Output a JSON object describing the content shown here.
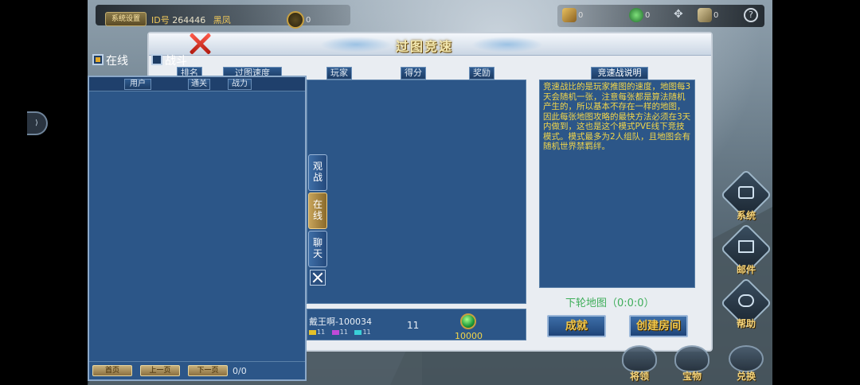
{
  "topbar": {
    "settings_label": "系统设置",
    "id_label": "ID号",
    "id_value": "264446",
    "nick": "黑凤",
    "coin_value": "0",
    "res_gold": "0",
    "res_gem": "0",
    "res_scroll": "0"
  },
  "panel": {
    "title": "过图竞速",
    "columns": [
      "排名",
      "过图速度",
      "玩家",
      "得分",
      "奖励"
    ],
    "desc_title": "竞速战说明",
    "desc_text": "竞速战比的是玩家推图的速度，地图每3天会随机一张，注意每张都是算法随机产生的，所以基本不存在一样的地图，因此每张地图攻略的最快方法必须在3天内做到，这也是这个模式PVE线下竞技模式。模式最多为2人组队，且地图会有随机世界禁羁绊。",
    "next_map": "下轮地图（0:0:0）",
    "achievement_btn": "成就",
    "create_room_btn": "创建房间",
    "side_tabs": [
      "观战",
      "在线",
      "聊天"
    ],
    "me": {
      "name": "戴王啊-100034",
      "stat1": "11",
      "stat2": "11",
      "stat3": "11",
      "score": "11",
      "reward": "10000"
    }
  },
  "left": {
    "tab_online": "在线",
    "tab_battle": "战斗",
    "columns": [
      "用户",
      "通关",
      "战力"
    ],
    "first_page": "首页",
    "prev_page": "上一页",
    "next_page": "下一页",
    "page_count": "0/0"
  },
  "side_menu": [
    "系统",
    "邮件",
    "帮助"
  ],
  "bottom_menu": [
    "将领",
    "宝物",
    "兑换"
  ],
  "colors": {
    "panel_blue": "#2c5688",
    "gold_text": "#f3d64a",
    "green_text": "#3fae5a"
  }
}
